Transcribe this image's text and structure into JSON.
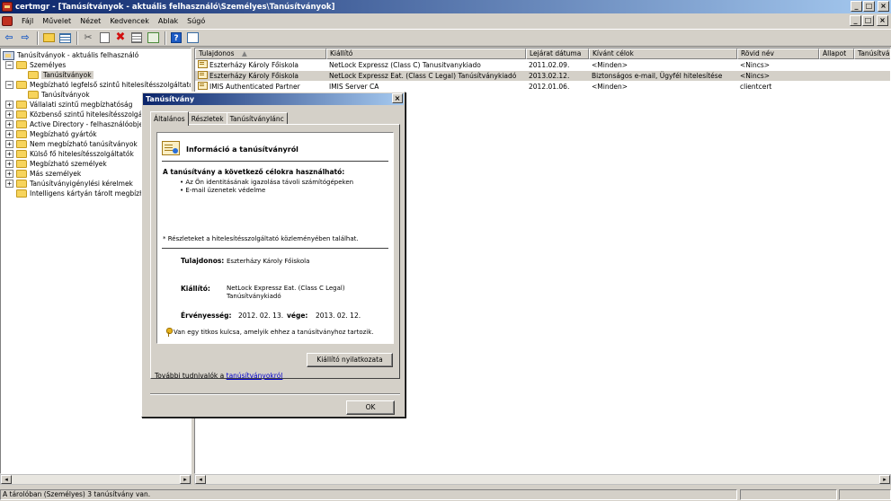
{
  "window": {
    "title": "certmgr - [Tanúsítványok - aktuális felhasználó\\Személyes\\Tanúsítványok]",
    "controls": {
      "minimize": "_",
      "maximize": "□",
      "close": "×"
    }
  },
  "menu": {
    "items": [
      "Fájl",
      "Művelet",
      "Nézet",
      "Kedvencek",
      "Ablak",
      "Súgó"
    ]
  },
  "toolbar": {
    "buttons": [
      "back-icon",
      "forward-icon",
      "up-folder-icon",
      "show-tree-icon",
      "cut-icon",
      "copy-icon",
      "delete-icon",
      "properties-icon",
      "export-icon",
      "help-icon",
      "view-icon"
    ]
  },
  "tree": {
    "root": "Tanúsítványok - aktuális felhasználó",
    "items": [
      {
        "label": "Személyes",
        "expander": "−"
      },
      {
        "label": "Tanúsítványok",
        "expander": ""
      },
      {
        "label": "Megbízható legfelső szintű hitelesítésszolgáltatók",
        "expander": "−"
      },
      {
        "label": "Tanúsítványok",
        "expander": ""
      },
      {
        "label": "Vállalati szintű megbízhatóság",
        "expander": "+"
      },
      {
        "label": "Közbenső szintű hitelesítésszolgálta",
        "expander": "+"
      },
      {
        "label": "Active Directory - felhasználóobjekt",
        "expander": "+"
      },
      {
        "label": "Megbízható gyártók",
        "expander": "+"
      },
      {
        "label": "Nem megbízható tanúsítványok",
        "expander": "+"
      },
      {
        "label": "Külső fő hitelesítésszolgáltatók",
        "expander": "+"
      },
      {
        "label": "Megbízható személyek",
        "expander": "+"
      },
      {
        "label": "Más személyek",
        "expander": "+"
      },
      {
        "label": "Tanúsítványigénylési kérelmek",
        "expander": "+"
      },
      {
        "label": "Intelligens kártyán tárolt megbízhat",
        "expander": ""
      }
    ]
  },
  "list": {
    "columns": [
      "Tulajdonos",
      "Kiállító",
      "Lejárat dátuma",
      "Kívánt célok",
      "Rövid név",
      "Állapot",
      "Tanúsítványsablon"
    ],
    "sort_indicator": "▲",
    "rows": [
      [
        "Eszterházy Károly Főiskola",
        "NetLock Expressz (Class C) Tanusitvanykiado",
        "2011.02.09.",
        "<Minden>",
        "<Nincs>",
        "",
        ""
      ],
      [
        "Eszterházy Károly Főiskola",
        "NetLock Expressz Eat. (Class C Legal) Tanúsítványkiadó",
        "2013.02.12.",
        "Biztonságos e-mail, Ügyfél hitelesítése",
        "<Nincs>",
        "",
        ""
      ],
      [
        "IMIS Authenticated Partner",
        "IMIS Server CA",
        "2012.01.06.",
        "<Minden>",
        "clientcert",
        "",
        ""
      ]
    ],
    "selected_row": 1
  },
  "status": {
    "text": "A tárolóban (Személyes) 3 tanúsítvány van."
  },
  "dialog": {
    "title": "Tanúsítvány",
    "close": "×",
    "tabs": [
      "Általános",
      "Részletek",
      "Tanúsítványlánc"
    ],
    "active_tab": 0,
    "info_heading": "Információ a tanúsítványról",
    "purpose_title": "A tanúsítvány a következő célokra használható:",
    "purposes": [
      "• Az Ön identitásának igazolása távoli számítógépeken",
      "• E-mail üzenetek védelme"
    ],
    "footnote": "* Részleteket a hitelesítésszolgáltató közleményében találhat.",
    "owner_label": "Tulajdonos:",
    "owner_value": "Eszterházy Károly Főiskola",
    "issuer_label": "Kiállító:",
    "issuer_value_1": "NetLock Expressz Eat. (Class C Legal)",
    "issuer_value_2": "Tanúsítványkiadó",
    "validity_label": "Érvényesség:",
    "validity_from": "2012. 02. 13.",
    "validity_to_label": "vége:",
    "validity_to": "2013. 02. 12.",
    "private_key_note": "Van egy titkos kulcsa, amelyik ehhez a tanúsítványhoz tartozik.",
    "issuer_statement_button": "Kiállító nyilatkozata",
    "learn_more_prefix": "További tudnivalók a ",
    "learn_more_link": "tanúsítványokról",
    "ok_button": "OK"
  }
}
